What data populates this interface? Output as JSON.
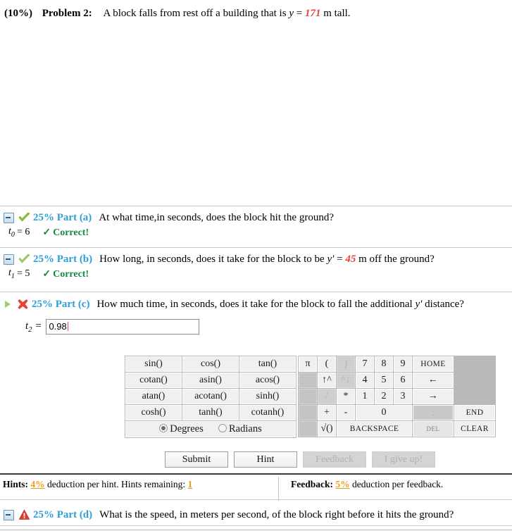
{
  "problem": {
    "percent": "(10%)",
    "number": "Problem 2:",
    "text_before": "A block falls from rest off a building that is",
    "var": "y",
    "equals": "=",
    "value": "171",
    "text_after": "m tall."
  },
  "parts": [
    {
      "weight": "25% Part (a)",
      "question": "At what time,in seconds, does the block hit the ground?",
      "answer_var": "t",
      "answer_sub": "0",
      "answer_eq": "= 6",
      "status_text": "Correct!",
      "status_icon": "green-check-icon",
      "toggle_icon": "collapse-box-icon"
    },
    {
      "weight": "25% Part (b)",
      "question_pre": "How long, in seconds, does it take for the block to be",
      "question_var": "y′",
      "question_eq": "=",
      "question_val": "45",
      "question_post": "m off the ground?",
      "answer_var": "t",
      "answer_sub": "1",
      "answer_eq": "= 5",
      "status_text": "Correct!",
      "status_icon": "green-check-icon",
      "toggle_icon": "collapse-box-icon"
    },
    {
      "weight": "25% Part (c)",
      "question_pre": "How much time, in seconds, does it take for the block to fall the additional",
      "question_var": "y′",
      "question_post": "distance?",
      "status_icon": "red-x-icon",
      "toggle_icon": "expand-play-icon",
      "input_label_var": "t",
      "input_label_sub": "2",
      "input_label_eq": "=",
      "input_value": "0.98",
      "input_placeholder": ""
    },
    {
      "weight": "25% Part (d)",
      "question": "What is the speed, in meters per second, of the block right before it hits the ground?",
      "status_icon": "red-warning-icon",
      "toggle_icon": "collapse-box-icon"
    }
  ],
  "calculator": {
    "functions": [
      [
        "sin()",
        "cos()",
        "tan()"
      ],
      [
        "cotan()",
        "asin()",
        "acos()"
      ],
      [
        "atan()",
        "acotan()",
        "sinh()"
      ],
      [
        "cosh()",
        "tanh()",
        "cotanh()"
      ]
    ],
    "angle_mode": {
      "degrees_label": "Degrees",
      "radians_label": "Radians",
      "selected": "Degrees"
    },
    "keypad_rows": [
      [
        {
          "label": "π",
          "type": "key"
        },
        {
          "label": "(",
          "type": "key"
        },
        {
          "label": ")",
          "type": "disabled"
        },
        {
          "label": "7",
          "type": "key"
        },
        {
          "label": "8",
          "type": "key"
        },
        {
          "label": "9",
          "type": "key"
        },
        {
          "label": "HOME",
          "type": "nav"
        }
      ],
      [
        {
          "label": "",
          "type": "blank"
        },
        {
          "label": "↑^",
          "type": "key"
        },
        {
          "label": "^↓",
          "type": "disabled"
        },
        {
          "label": "4",
          "type": "key"
        },
        {
          "label": "5",
          "type": "key"
        },
        {
          "label": "6",
          "type": "key"
        },
        {
          "label": "←",
          "type": "arrow"
        }
      ],
      [
        {
          "label": "",
          "type": "blank"
        },
        {
          "label": "/",
          "type": "disabled"
        },
        {
          "label": "*",
          "type": "key"
        },
        {
          "label": "1",
          "type": "key"
        },
        {
          "label": "2",
          "type": "key"
        },
        {
          "label": "3",
          "type": "key"
        },
        {
          "label": "→",
          "type": "arrow"
        }
      ],
      [
        {
          "label": "",
          "type": "blank"
        },
        {
          "label": "+",
          "type": "key"
        },
        {
          "label": "-",
          "type": "key"
        },
        {
          "label": "0",
          "type": "key-wide"
        },
        {
          "label": ".",
          "type": "dot-disabled"
        },
        {
          "label": "END",
          "type": "nav"
        }
      ],
      [
        {
          "label": "",
          "type": "blank"
        },
        {
          "label": "√()",
          "type": "sqrt"
        },
        {
          "label": "BACKSPACE",
          "type": "bksp"
        },
        {
          "label": "DEL",
          "type": "del"
        },
        {
          "label": "CLEAR",
          "type": "nav"
        }
      ]
    ]
  },
  "actions": {
    "submit": "Submit",
    "hint": "Hint",
    "feedback": "Feedback",
    "give_up": "I give up!"
  },
  "hints_bar": {
    "hints_label": "Hints:",
    "hints_pct": "4%",
    "hints_text": "deduction per hint. Hints remaining:",
    "hints_remaining": "1",
    "feedback_label": "Feedback:",
    "feedback_pct": "5%",
    "feedback_text": "deduction per feedback."
  },
  "colors": {
    "part_label": "#2e9fd4",
    "value_red": "#e8413c",
    "correct_green": "#138a3d",
    "deduction_orange": "#ef9b23"
  }
}
